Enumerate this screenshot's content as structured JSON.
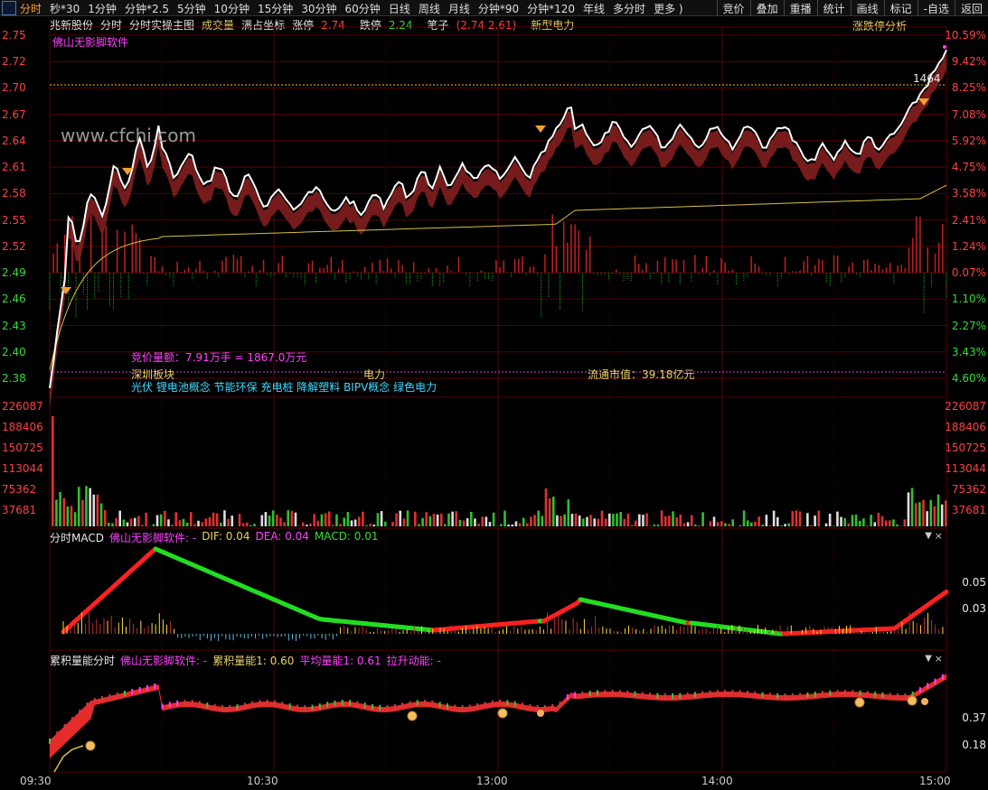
{
  "toolbar": {
    "items": [
      "分时",
      "秒*30",
      "1分钟",
      "分钟*2.5",
      "5分钟",
      "10分钟",
      "15分钟",
      "30分钟",
      "60分钟",
      "日线",
      "周线",
      "月线",
      "分钟*90",
      "分钟*120",
      "年线",
      "多分时",
      "更多 )"
    ],
    "active_index": 0,
    "right_buttons": [
      "竞价",
      "叠加",
      "重播",
      "统计",
      "画线",
      "标记",
      "-自选",
      "返回"
    ]
  },
  "infobar": {
    "stock_name": "兆新股份",
    "mode": "分时",
    "main_chart_label": "分时实操主图",
    "volume_label": "成交量",
    "coord_label": "满占坐标",
    "up_limit_label": "涨停",
    "up_limit_value": "2.74",
    "down_limit_label": "跌停",
    "down_limit_value": "2.24",
    "brush_label": "笔子",
    "brush_values": "(2.74 2.61)",
    "concept": "新型电力",
    "zd_analysis": "涨跌停分析"
  },
  "software_label": "佛山无影脚软件",
  "watermark": "www.cfchi.com",
  "price_axis": {
    "left": [
      "2.75",
      "2.72",
      "2.70",
      "2.67",
      "2.64",
      "2.61",
      "2.58",
      "2.55",
      "2.52",
      "2.49",
      "2.46",
      "2.43",
      "2.40",
      "2.38"
    ],
    "right": [
      "10.59%",
      "9.42%",
      "8.25%",
      "7.08%",
      "5.92%",
      "4.75%",
      "3.58%",
      "2.41%",
      "1.24%",
      "0.07%",
      "1.10%",
      "2.27%",
      "3.43%",
      "4.60%"
    ]
  },
  "marker_value": "1464",
  "annotations": {
    "auction": "竞价量额：7.91万手 = 1867.0万元",
    "board_label": "深圳板块",
    "industry": "电力",
    "market_cap": "流通市值：39.18亿元",
    "concepts": "光伏  锂电池概念  节能环保  充电桩  降解塑料  BIPV概念  绿色电力"
  },
  "volume_axis": [
    "226087",
    "188406",
    "150725",
    "113044",
    "75362",
    "37681"
  ],
  "macd": {
    "title": "分时MACD",
    "source": "佛山无影脚软件: -",
    "dif": "DIF: 0.04",
    "dea": "DEA: 0.04",
    "macd": "MACD: 0.01",
    "axis": [
      "0.05",
      "0.03"
    ]
  },
  "energy": {
    "title": "累积量能分时",
    "source": "佛山无影脚软件: -",
    "cum1": "累积量能1: 0.60",
    "avg1": "平均量能1: 0.61",
    "pull": "拉升动能: -",
    "axis": [
      "0.37",
      "0.18"
    ]
  },
  "time_axis": [
    "09:30",
    "10:30",
    "13:00",
    "14:00",
    "15:00"
  ],
  "colors": {
    "up": "#ff3030",
    "down": "#22cc22",
    "price_line": "#ffffff",
    "avg_line": "#d8c040",
    "grid": "#5a0000"
  }
}
